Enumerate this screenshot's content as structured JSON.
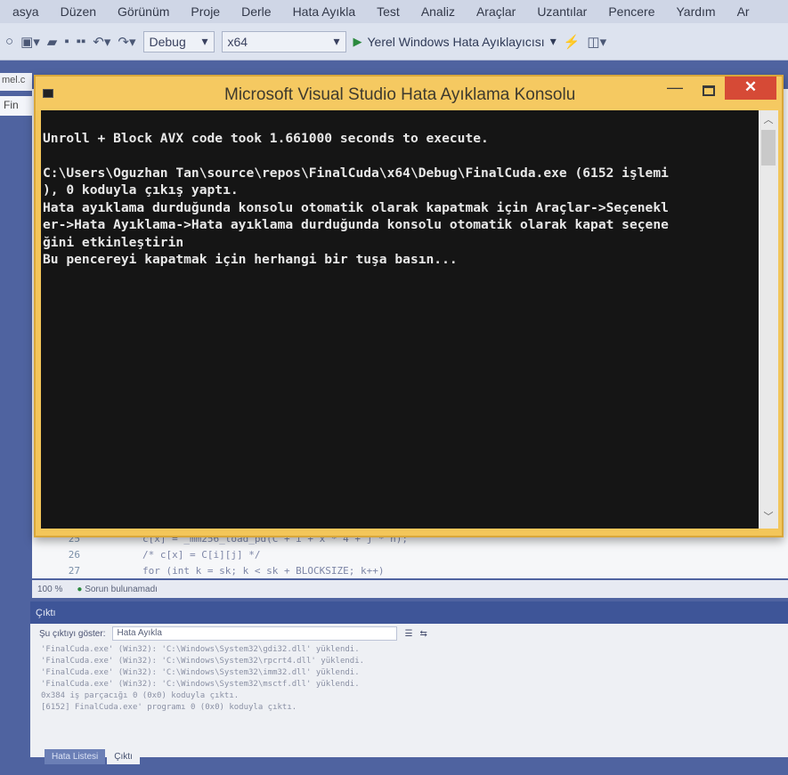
{
  "menu": [
    "asya",
    "Düzen",
    "Görünüm",
    "Proje",
    "Derle",
    "Hata Ayıkla",
    "Test",
    "Analiz",
    "Araçlar",
    "Uzantılar",
    "Pencere",
    "Yardım",
    "Ar"
  ],
  "toolbar": {
    "config": "Debug",
    "platform": "x64",
    "run_label": "Yerel Windows Hata Ayıklayıcısı"
  },
  "ide": {
    "left_tab": "mel.c",
    "file_tab": "Fin",
    "code_lines": [
      {
        "num": "25",
        "code": "c[x] = _mm256_load_pd(C + i + x * 4 + j * n);"
      },
      {
        "num": "26",
        "code": "/* c[x] = C[i][j] */"
      },
      {
        "num": "27",
        "code": "for (int k = sk; k < sk + BLOCKSIZE; k++)"
      }
    ],
    "zoom": "100 %",
    "status": "Sorun bulunamadı"
  },
  "output": {
    "title": "Çıktı",
    "show_from_label": "Şu çıktıyı göster:",
    "show_from_value": "Hata Ayıkla",
    "lines": [
      "'FinalCuda.exe' (Win32): 'C:\\Windows\\System32\\gdi32.dll' yüklendi.",
      "'FinalCuda.exe' (Win32): 'C:\\Windows\\System32\\rpcrt4.dll' yüklendi.",
      "'FinalCuda.exe' (Win32): 'C:\\Windows\\System32\\imm32.dll' yüklendi.",
      "'FinalCuda.exe' (Win32): 'C:\\Windows\\System32\\msctf.dll' yüklendi.",
      "0x384 iş parçacığı 0 (0x0) koduyla çıktı.",
      "[6152] FinalCuda.exe' programı 0 (0x0) koduyla çıktı."
    ],
    "tabs": [
      "Hata Listesi",
      "Çıktı"
    ]
  },
  "console": {
    "title": "Microsoft Visual Studio Hata Ayıklama Konsolu",
    "close_glyph": "✕",
    "lines": [
      "Unroll + Block AVX code took 1.661000 seconds to execute.",
      "",
      "C:\\Users\\Oguzhan Tan\\source\\repos\\FinalCuda\\x64\\Debug\\FinalCuda.exe (6152 işlemi",
      "), 0 koduyla çıkış yaptı.",
      "Hata ayıklama durduğunda konsolu otomatik olarak kapatmak için Araçlar->Seçenekl",
      "er->Hata Ayıklama->Hata ayıklama durduğunda konsolu otomatik olarak kapat seçene",
      "ğini etkinleştirin",
      "Bu pencereyi kapatmak için herhangi bir tuşa basın..."
    ]
  },
  "colors": {
    "console_bg": "#151515",
    "console_frame": "#f3c65a",
    "close_button": "#d64a36",
    "ide_accent": "#3e5598"
  }
}
